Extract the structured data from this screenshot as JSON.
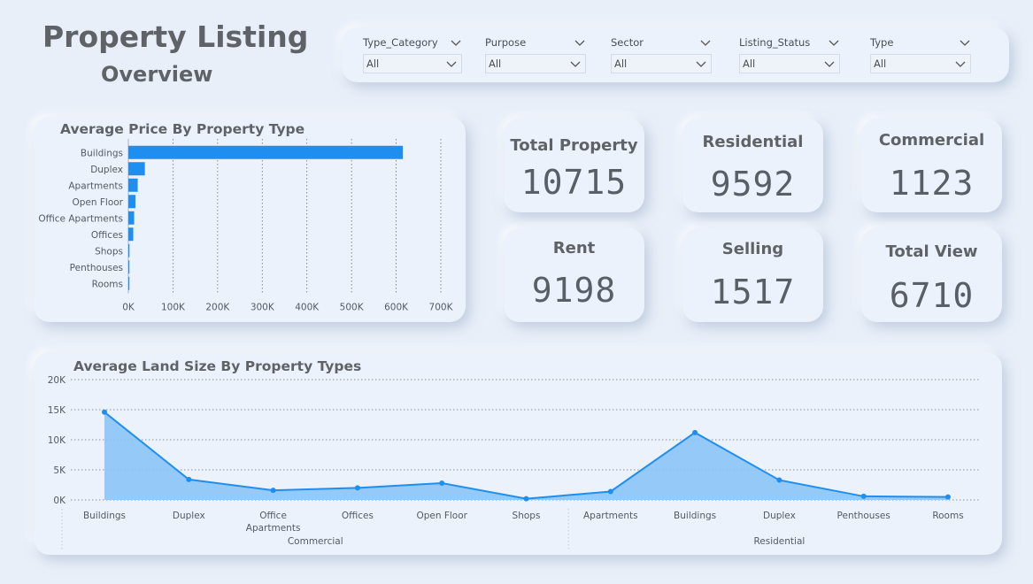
{
  "header": {
    "title": "Property Listing",
    "subtitle": "Overview"
  },
  "filters": [
    {
      "label": "Type_Category",
      "value": "All"
    },
    {
      "label": "Purpose",
      "value": "All"
    },
    {
      "label": "Sector",
      "value": "All"
    },
    {
      "label": "Listing_Status",
      "value": "All"
    },
    {
      "label": "Type",
      "value": "All"
    }
  ],
  "kpis": {
    "total_property": {
      "label": "Total Property",
      "value": "10715"
    },
    "residential": {
      "label": "Residential",
      "value": "9592"
    },
    "commercial": {
      "label": "Commercial",
      "value": "1123"
    },
    "rent": {
      "label": "Rent",
      "value": "9198"
    },
    "selling": {
      "label": "Selling",
      "value": "1517"
    },
    "total_view": {
      "label": "Total View",
      "value": "6710"
    }
  },
  "chart_data": [
    {
      "type": "bar",
      "orientation": "horizontal",
      "title": "Average Price By Property Type",
      "categories": [
        "Buildings",
        "Duplex",
        "Apartments",
        "Open Floor",
        "Office Apartments",
        "Offices",
        "Shops",
        "Penthouses",
        "Rooms"
      ],
      "values": [
        615000,
        37000,
        21000,
        16000,
        13000,
        11000,
        2500,
        2000,
        1500
      ],
      "xlim": [
        0,
        700000
      ],
      "xticks": [
        "0K",
        "100K",
        "200K",
        "300K",
        "400K",
        "500K",
        "600K",
        "700K"
      ],
      "grid": true,
      "color": "#1e8ff0"
    },
    {
      "type": "area",
      "title": "Average Land Size By Property Types",
      "categories": [
        "Buildings",
        "Duplex",
        "Office Apartments",
        "Offices",
        "Open Floor",
        "Shops",
        "Apartments",
        "Buildings",
        "Duplex",
        "Penthouses",
        "Rooms"
      ],
      "groups": [
        {
          "name": "Commercial",
          "count": 6
        },
        {
          "name": "Residential",
          "count": 5
        }
      ],
      "values": [
        14600,
        3400,
        1600,
        2000,
        2800,
        200,
        1400,
        11200,
        3300,
        600,
        500
      ],
      "ylim": [
        0,
        20000
      ],
      "yticks": [
        "0K",
        "5K",
        "10K",
        "15K",
        "20K"
      ],
      "grid": true,
      "color": "#1e8ff0"
    }
  ]
}
